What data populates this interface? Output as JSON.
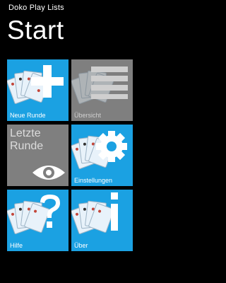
{
  "app": {
    "title": "Doko Play Lists"
  },
  "page": {
    "title": "Start"
  },
  "tiles": [
    {
      "label": "Neue Runde",
      "icon": "plus-icon",
      "color": "#1ba1e2"
    },
    {
      "label": "Übersicht",
      "icon": "list-icon",
      "color": "#7f7f7f"
    },
    {
      "label": "",
      "big_text_line1": "Letzte",
      "big_text_line2": "Runde",
      "icon": "eye-icon",
      "color": "#7f7f7f"
    },
    {
      "label": "Einstellungen",
      "icon": "gear-icon",
      "color": "#1ba1e2"
    },
    {
      "label": "Hilfe",
      "icon": "question-mark-icon",
      "color": "#1ba1e2"
    },
    {
      "label": "Über",
      "icon": "info-icon",
      "color": "#1ba1e2"
    }
  ]
}
